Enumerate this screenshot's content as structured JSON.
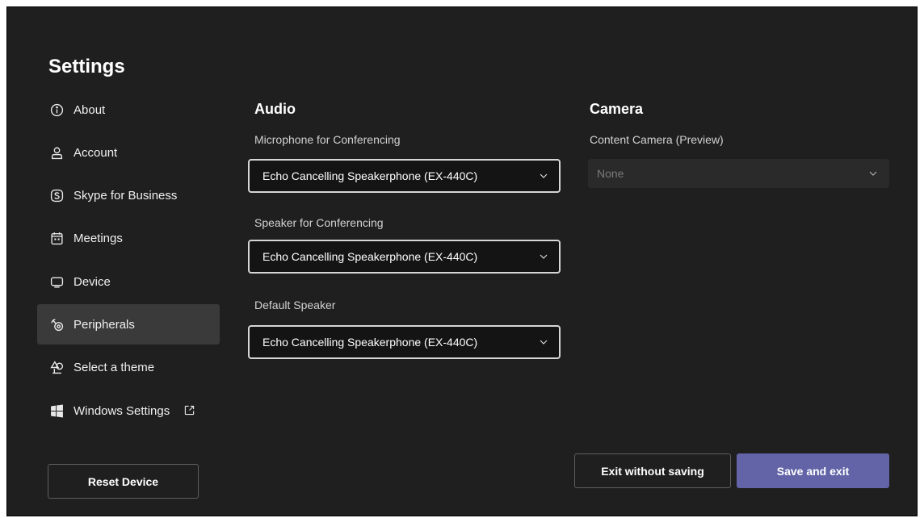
{
  "settings": {
    "title": "Settings"
  },
  "sidebar": {
    "items": [
      {
        "label": "About",
        "icon": "info-icon"
      },
      {
        "label": "Account",
        "icon": "person-icon"
      },
      {
        "label": "Skype for Business",
        "icon": "skype-icon"
      },
      {
        "label": "Meetings",
        "icon": "calendar-icon"
      },
      {
        "label": "Device",
        "icon": "device-icon"
      },
      {
        "label": "Peripherals",
        "icon": "peripherals-icon",
        "active": true
      },
      {
        "label": "Select a theme",
        "icon": "theme-icon"
      },
      {
        "label": "Windows Settings",
        "icon": "windows-icon",
        "external": "external-link-icon"
      }
    ],
    "reset_label": "Reset Device"
  },
  "audio": {
    "title": "Audio",
    "microphone": {
      "label": "Microphone for Conferencing",
      "value": "Echo Cancelling Speakerphone (EX-440C)"
    },
    "speaker": {
      "label": "Speaker for Conferencing",
      "value": "Echo Cancelling Speakerphone (EX-440C)"
    },
    "default_speaker": {
      "label": "Default Speaker",
      "value": "Echo Cancelling Speakerphone (EX-440C)"
    }
  },
  "camera": {
    "title": "Camera",
    "content_camera": {
      "label": "Content Camera (Preview)",
      "value": "None"
    }
  },
  "footer": {
    "exit_label": "Exit without saving",
    "save_label": "Save and exit"
  },
  "colors": {
    "background": "#1f1f1f",
    "active_item": "#3a3a3a",
    "accent": "#6264a7"
  }
}
